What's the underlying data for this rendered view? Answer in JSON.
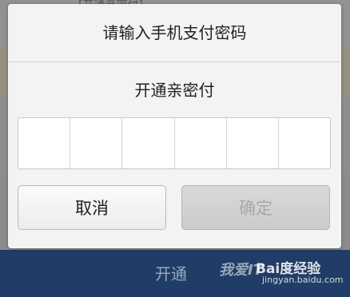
{
  "background": {
    "top_hint": "[开通亲密付]",
    "bottom_button_label": "开通"
  },
  "dialog": {
    "title": "请输入手机支付密码",
    "subtitle": "开通亲密付",
    "password_cells": [
      "",
      "",
      "",
      "",
      "",
      ""
    ],
    "cancel_label": "取消",
    "confirm_label": "确定"
  },
  "watermark": {
    "text": "我爱IT",
    "brand": "Bai度经验",
    "url": "jingyan.baidu.com"
  }
}
